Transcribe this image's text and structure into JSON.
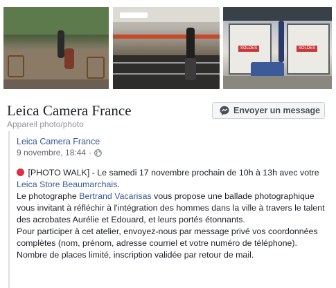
{
  "page": {
    "name": "Leica Camera France",
    "category": "Appareil photo/photo",
    "message_button": "Envoyer un message"
  },
  "post": {
    "author": "Leica Camera France",
    "date": "9 novembre, 18:44",
    "separator": "·",
    "privacy_icon": "globe-icon",
    "line1_prefix": "[PHOTO WALK] - Le samedi 17 novembre prochain de 10h à 13h avec votre ",
    "store_link": "Leica Store Beaumarchais",
    "line1_suffix": ".",
    "line2_prefix": "Le photographe ",
    "photographer_link": "Bertrand Vacarisas",
    "line2_suffix": " vous propose une ballade photographique vous invitant à réfléchir à l'intégration des hommes dans la ville à travers le talent des acrobates Aurélie et Edouard, et leurs portés étonnants.",
    "line3": "Pour participer à cet atelier, envoyez-nous par message privé vos coordonnées complètes (nom, prénom, adresse courriel et votre numéro de téléphone).",
    "line4": "Nombre de places limité, inscription validée par retour de mail."
  },
  "photos": {
    "sign_text": "SOLDES"
  },
  "colors": {
    "link": "#365899",
    "red_emoji": "#dd2e44",
    "secondary_text": "#90949c"
  }
}
